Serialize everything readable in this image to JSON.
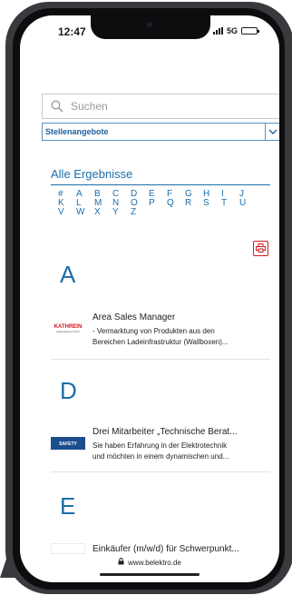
{
  "status_bar": {
    "time": "12:47",
    "network": "5G"
  },
  "search": {
    "placeholder": "Suchen"
  },
  "category_select": {
    "value": "Stellenangebote"
  },
  "results": {
    "heading": "Alle Ergebnisse"
  },
  "alphabet": [
    "#",
    "A",
    "B",
    "C",
    "D",
    "E",
    "F",
    "G",
    "H",
    "I",
    "J",
    "K",
    "L",
    "M",
    "N",
    "O",
    "P",
    "Q",
    "R",
    "S",
    "T",
    "U",
    "V",
    "W",
    "X",
    "Y",
    "Z"
  ],
  "sections": [
    {
      "letter": "A",
      "jobs": [
        {
          "logo_text": "KATHREIN",
          "logo_subtext": "Digital Systems GmbH",
          "title": "Area Sales Manager",
          "desc_line1": "- Vermarktung von Produkten aus den",
          "desc_line2": "Bereichen Ladeinfrastruktur (Wallboxen)..."
        }
      ]
    },
    {
      "letter": "D",
      "jobs": [
        {
          "logo_text": "SAFETY",
          "title": "Drei Mitarbeiter „Technische Berat...",
          "desc_line1": "Sie haben Erfahrung in der Elektrotechnik",
          "desc_line2": "und möchten in einem dynamischen und..."
        }
      ]
    },
    {
      "letter": "E",
      "jobs": [
        {
          "title": "Einkäufer (m/w/d) für Schwerpunkt..."
        }
      ]
    }
  ],
  "browser": {
    "url": "www.belektro.de"
  },
  "colors": {
    "accent": "#1b6ea8",
    "bookmark": "#cc1f1f",
    "brand_red": "#d2141a",
    "brand_blue": "#1c4e8c"
  }
}
